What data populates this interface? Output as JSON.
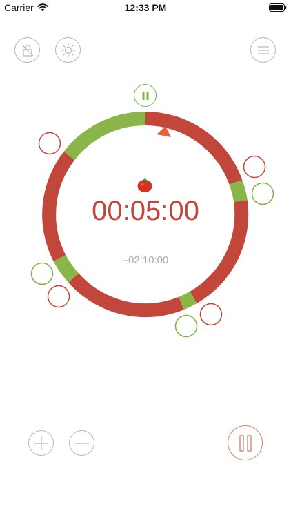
{
  "status_bar": {
    "carrier": "Carrier",
    "time": "12:33 PM"
  },
  "timer": {
    "main": "00:05:00",
    "sub": "–02:10:00"
  },
  "colors": {
    "work": "#c0473a",
    "break": "#8ab548",
    "pause_main": "#e07a5a",
    "pause_top": "#7cb342",
    "icon_gray": "#b5b5b5"
  },
  "icons": {
    "lock": "unlock-icon",
    "brightness": "sun-icon",
    "menu": "menu-icon",
    "add": "plus-icon",
    "minus": "minus-icon",
    "pause": "pause-icon",
    "tomato": "tomato-icon",
    "pointer": "triangle-pointer-icon"
  }
}
